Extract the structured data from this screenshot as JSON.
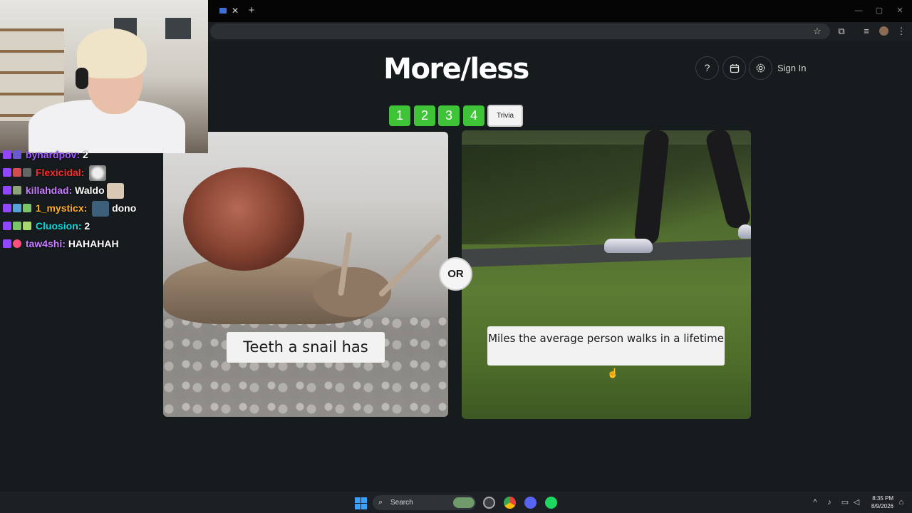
{
  "browser": {
    "tab_close": "✕",
    "new_tab": "+",
    "window_controls": [
      "—",
      "▢",
      "✕"
    ],
    "toolbar_icons": [
      "star-icon",
      "extensions-icon",
      "media-icon",
      "menu-icon"
    ]
  },
  "game": {
    "logo": "More/less",
    "help_label": "?",
    "sign_in": "Sign In",
    "levels": [
      "1",
      "2",
      "3",
      "4"
    ],
    "trivia_label": "Trivia",
    "left_question": "Teeth a snail has",
    "right_question": "Miles the average person walks in a lifetime",
    "or_label": "OR"
  },
  "chat": {
    "messages": [
      {
        "user": "bynardpov",
        "text": "2",
        "color": "#a35cff"
      },
      {
        "user": "Flexicidal",
        "text": "",
        "color": "#ff2a2a"
      },
      {
        "user": "killahdad",
        "text": "Waldo",
        "color": "#c77dff"
      },
      {
        "user": "1_mysticx",
        "text": "dono",
        "color": "#ffb020"
      },
      {
        "user": "Cluosion",
        "text": "2",
        "color": "#00e0e0"
      },
      {
        "user": "taw4shi",
        "text": "HAHAHAH",
        "color": "#c77dff"
      }
    ]
  },
  "taskbar": {
    "search_label": "Search",
    "time": "8:35 PM",
    "date": "8/9/2026"
  },
  "colors": {
    "page_bg": "#161b1d",
    "level_green": "#3ec436",
    "card_text_bg": "#f2f2f2"
  }
}
